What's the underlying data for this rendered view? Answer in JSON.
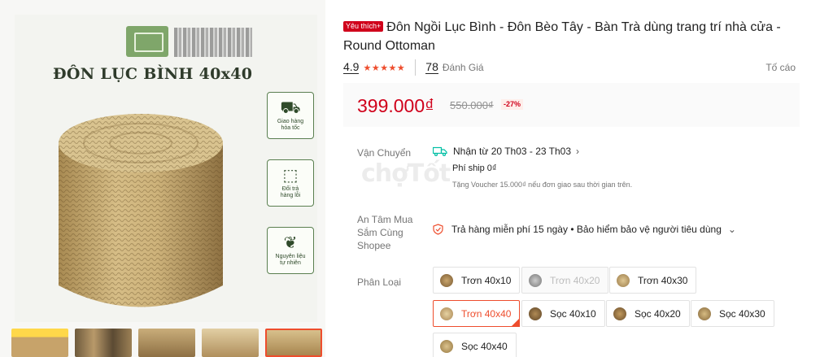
{
  "gallery": {
    "brand_name": "",
    "heading": "ĐÔN LỤC BÌNH 40x40",
    "badges": [
      {
        "icon": "delivery-truck-icon",
        "label": "Giao hàng\nhỏa tốc"
      },
      {
        "icon": "return-box-icon",
        "label": "Đổi trả\nhàng lỗi"
      },
      {
        "icon": "leaf-icon",
        "label": "Nguyên liệu\ntự nhiên"
      }
    ],
    "thumbnails": 5
  },
  "product": {
    "favorite_badge": "Yêu thích+",
    "title": "Đôn Ngồi Lục Bình - Đôn Bèo Tây - Bàn Trà dùng trang trí nhà cửa - Round Ottoman",
    "rating": "4.9",
    "stars": "★★★★★",
    "review_count": "78",
    "review_label": "Đánh Giá",
    "report_label": "Tố cáo"
  },
  "price": {
    "current": "399.000₫",
    "original": "550.000₫",
    "discount": "-27%"
  },
  "shipping": {
    "label": "Vận Chuyển",
    "delivery_window": "Nhận từ 20 Th03 - 23 Th03",
    "fee": "Phí ship 0₫",
    "voucher_note": "Tặng Voucher 15.000₫ nếu đơn giao sau thời gian trên."
  },
  "assurance": {
    "label": "An Tâm Mua\nSắm Cùng\nShopee",
    "text": "Trả hàng miễn phí 15 ngày • Bảo hiểm bảo vệ người tiêu dùng"
  },
  "variants": {
    "label": "Phân Loại",
    "options": [
      {
        "label": "Trơn 40x10",
        "state": "normal"
      },
      {
        "label": "Trơn 40x20",
        "state": "disabled"
      },
      {
        "label": "Trơn 40x30",
        "state": "normal"
      },
      {
        "label": "Trơn 40x40",
        "state": "selected"
      },
      {
        "label": "Sọc 40x10",
        "state": "normal"
      },
      {
        "label": "Sọc 40x20",
        "state": "normal"
      },
      {
        "label": "Sọc 40x30",
        "state": "normal"
      },
      {
        "label": "Sọc 40x40",
        "state": "normal"
      }
    ]
  },
  "watermark": "chợTốt",
  "colors": {
    "accent": "#ee4d2d",
    "price_red": "#d0011b",
    "badge_green": "#5a7f50"
  }
}
